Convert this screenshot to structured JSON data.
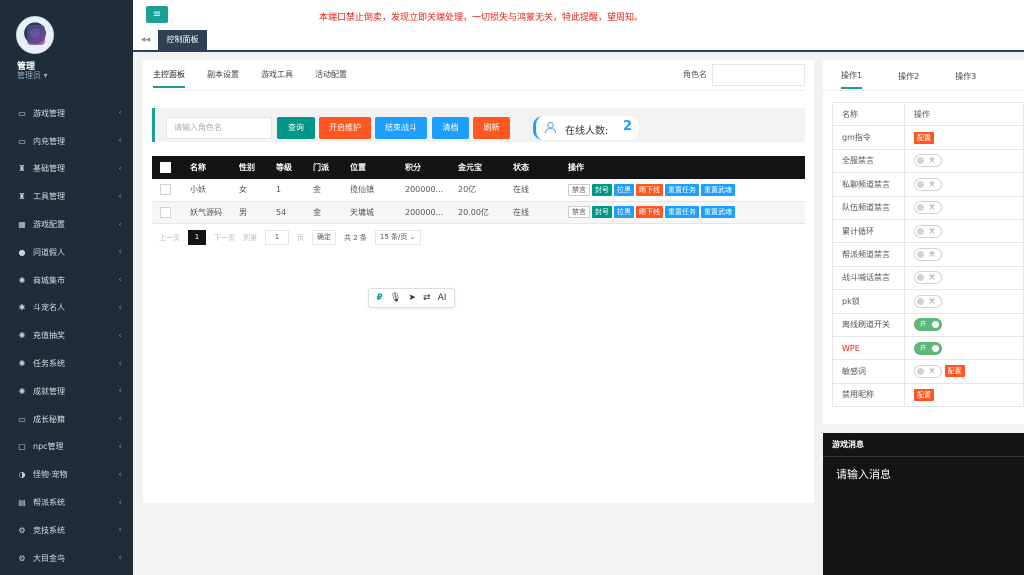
{
  "user": {
    "name": "管理",
    "role": "管理员 ▾"
  },
  "sidebar": {
    "items": [
      {
        "label": "游戏管理",
        "icon": "▭"
      },
      {
        "label": "内充管理",
        "icon": "▭"
      },
      {
        "label": "基础管理",
        "icon": "♜"
      },
      {
        "label": "工具管理",
        "icon": "♜"
      },
      {
        "label": "游戏配置",
        "icon": "▦"
      },
      {
        "label": "问道假人",
        "icon": "●"
      },
      {
        "label": "商城集市",
        "icon": "✺"
      },
      {
        "label": "斗宠名人",
        "icon": "✱"
      },
      {
        "label": "充值抽奖",
        "icon": "✺"
      },
      {
        "label": "任务系统",
        "icon": "✺"
      },
      {
        "label": "成就管理",
        "icon": "✺"
      },
      {
        "label": "成长秘籍",
        "icon": "▭"
      },
      {
        "label": "npc管理",
        "icon": "▢"
      },
      {
        "label": "怪物·宠物",
        "icon": "◑"
      },
      {
        "label": "帮派系统",
        "icon": "▤"
      },
      {
        "label": "竞技系统",
        "icon": "⚙"
      },
      {
        "label": "大目金鸟",
        "icon": "⚙"
      }
    ]
  },
  "header": {
    "menu_icon": "≡",
    "notice": "本端口禁止倒卖，发现立即关端处理，一切损失与鸿蒙无关，特此提醒，望周知。"
  },
  "tabs": {
    "back": "◂◂",
    "active": "控制面板"
  },
  "main": {
    "subtabs": [
      "主控面板",
      "副本设置",
      "游戏工具",
      "活动配置"
    ],
    "role_label": "角色名",
    "search_placeholder": "请输入角色名",
    "buttons": {
      "query": "查询",
      "maintain": "开启维护",
      "end_battle": "结束战斗",
      "clear": "清档",
      "refresh": "刷新"
    },
    "online_label": "在线人数:",
    "online_count": "2",
    "columns": [
      "名称",
      "性别",
      "等级",
      "门派",
      "位置",
      "积分",
      "金元宝",
      "状态",
      "操作"
    ],
    "rows": [
      {
        "name": "小妖",
        "gender": "女",
        "level": "1",
        "sect": "金",
        "location": "揽仙镇",
        "score": "200000...",
        "gold": "20亿",
        "status": "在线"
      },
      {
        "name": "妖气源码",
        "gender": "男",
        "level": "54",
        "sect": "金",
        "location": "天墉城",
        "score": "200000...",
        "gold": "20.00亿",
        "status": "在线"
      }
    ],
    "row_actions": {
      "mute": "禁言",
      "ban": "封号",
      "pull": "拉黑",
      "kick": "踢下线",
      "reset_task": "重置任务",
      "reset_weapon": "重置武魂"
    },
    "pager": {
      "prev": "上一页",
      "page": "1",
      "next": "下一页",
      "goto": "到第",
      "input": "1",
      "unit": "页",
      "confirm": "确定",
      "total": "共 2 条",
      "per_page": "15 条/页 ⌄"
    }
  },
  "float_toolbar": [
    "₽",
    "🎙",
    "➤",
    "⇄",
    "AI"
  ],
  "right_panel": {
    "tabs": [
      "操作1",
      "操作2",
      "操作3"
    ],
    "head": {
      "name": "名称",
      "op": "操作"
    },
    "config_label": "配置",
    "off_label": "关",
    "on_label": "开",
    "rows": [
      {
        "name": "gm指令",
        "type": "config"
      },
      {
        "name": "全服禁言",
        "type": "switch",
        "on": false
      },
      {
        "name": "私聊频道禁言",
        "type": "switch",
        "on": false
      },
      {
        "name": "队伍频道禁言",
        "type": "switch",
        "on": false
      },
      {
        "name": "累计循环",
        "type": "switch",
        "on": false
      },
      {
        "name": "帮派频道禁言",
        "type": "switch",
        "on": false
      },
      {
        "name": "战斗喊话禁言",
        "type": "switch",
        "on": false
      },
      {
        "name": "pk锁",
        "type": "switch",
        "on": false
      },
      {
        "name": "离线刷道开关",
        "type": "switch",
        "on": true
      },
      {
        "name": "WPE",
        "type": "switch",
        "on": true,
        "red": true
      },
      {
        "name": "敏感词",
        "type": "switch+config",
        "on": false
      },
      {
        "name": "禁用昵称",
        "type": "config"
      }
    ]
  },
  "message": {
    "title": "游戏消息",
    "placeholder": "请输入消息"
  }
}
